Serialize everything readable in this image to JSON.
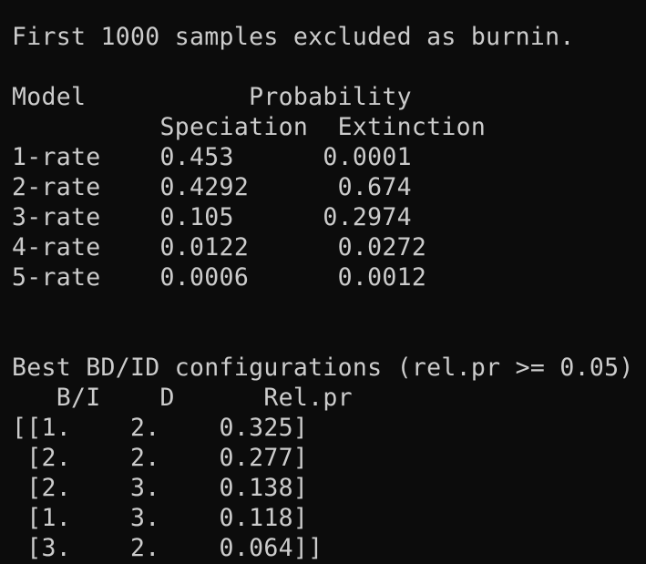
{
  "terminal": {
    "text_color": "#cccccc",
    "background_color": "#0c0c0c",
    "lines": [
      "First 1000 samples excluded as burnin.",
      "",
      "Model           Probability",
      "          Speciation  Extinction",
      "1-rate    0.453      0.0001",
      "2-rate    0.4292      0.674",
      "3-rate    0.105      0.2974",
      "4-rate    0.0122      0.0272",
      "5-rate    0.0006      0.0012",
      "",
      "",
      "Best BD/ID configurations (rel.pr >= 0.05)",
      "   B/I    D      Rel.pr",
      "[[1.    2.    0.325]",
      " [2.    2.    0.277]",
      " [2.    3.    0.138]",
      " [1.    3.    0.118]",
      " [3.    2.    0.064]]"
    ]
  }
}
